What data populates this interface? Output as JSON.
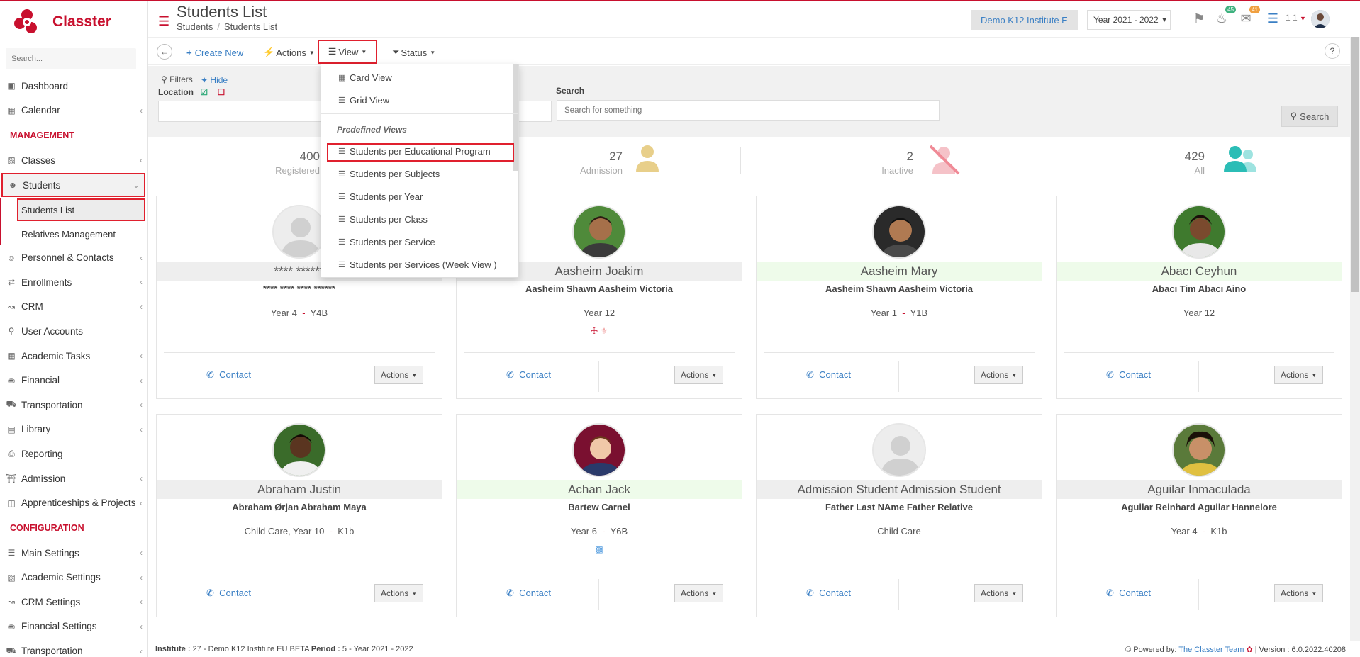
{
  "app": {
    "name": "Classter",
    "accent": "#c8102e",
    "link_color": "#3a7fc4"
  },
  "sidebar": {
    "search_placeholder": "Search...",
    "items": [
      {
        "label": "Dashboard",
        "icon": "laptop-icon"
      },
      {
        "label": "Calendar",
        "icon": "calendar-icon"
      }
    ],
    "management_header": "MANAGEMENT",
    "management": [
      {
        "label": "Classes",
        "icon": "classes-icon"
      },
      {
        "label": "Students",
        "icon": "students-icon"
      },
      {
        "label": "Students List"
      },
      {
        "label": "Relatives Management"
      },
      {
        "label": "Personnel & Contacts",
        "icon": "personnel-icon"
      },
      {
        "label": "Enrollments",
        "icon": "enrollments-icon"
      },
      {
        "label": "CRM",
        "icon": "crm-icon"
      },
      {
        "label": "User Accounts",
        "icon": "key-icon"
      },
      {
        "label": "Academic Tasks",
        "icon": "grid-icon"
      },
      {
        "label": "Financial",
        "icon": "coins-icon"
      },
      {
        "label": "Transportation",
        "icon": "bus-icon"
      },
      {
        "label": "Library",
        "icon": "library-icon"
      },
      {
        "label": "Reporting",
        "icon": "printer-icon"
      },
      {
        "label": "Admission",
        "icon": "bank-icon"
      },
      {
        "label": "Apprenticeships & Projects",
        "icon": "box-icon"
      }
    ],
    "configuration_header": "CONFIGURATION",
    "configuration": [
      {
        "label": "Main Settings",
        "icon": "sliders-icon"
      },
      {
        "label": "Academic Settings",
        "icon": "classes-icon"
      },
      {
        "label": "CRM Settings",
        "icon": "crm-icon"
      },
      {
        "label": "Financial Settings",
        "icon": "coins-icon"
      },
      {
        "label": "Transportation",
        "icon": "bus-icon"
      }
    ]
  },
  "header": {
    "title": "Students List",
    "breadcrumb": [
      "Students",
      "Students List"
    ],
    "institute": "Demo K12 Institute E",
    "year": "Year 2021 - 2022",
    "notif_count": "45",
    "mail_count": "41",
    "user_count": "1 1"
  },
  "toolbar": {
    "create": "Create New",
    "actions": "Actions",
    "view": "View",
    "status": "Status",
    "help": "?"
  },
  "filters": {
    "label": "Filters",
    "hide": "Hide",
    "location": "Location",
    "search_label": "Search",
    "search_placeholder": "Search for something",
    "search_button": "Search"
  },
  "view_menu": {
    "card_view": "Card View",
    "grid_view": "Grid View",
    "predefined_header": "Predefined Views",
    "predefined": [
      "Students per Educational Program",
      "Students per Subjects",
      "Students per Year",
      "Students per Class",
      "Students per Service",
      "Students per Services (Week View )"
    ]
  },
  "stats": [
    {
      "num": "400",
      "label": "Registered"
    },
    {
      "num": "27",
      "label": "Admission"
    },
    {
      "num": "2",
      "label": "Inactive"
    },
    {
      "num": "429",
      "label": "All"
    }
  ],
  "cards": [
    {
      "name": "**** ******",
      "parents": "**** **** **** ******",
      "year": "Year 4",
      "cls": "Y4B",
      "photo": "placeholder"
    },
    {
      "name": "Aasheim Joakim",
      "parents": "Aasheim Shawn Aasheim Victoria",
      "year": "Year 12",
      "cls": "",
      "photo": "boy1"
    },
    {
      "name": "Aasheim Mary",
      "parents": "Aasheim Shawn Aasheim Victoria",
      "year": "Year 1",
      "cls": "Y1B",
      "photo": "girl1"
    },
    {
      "name": "Abacı Ceyhun",
      "parents": "Abacı Tim Abacı Aino",
      "year": "Year 12",
      "cls": "",
      "photo": "boy2"
    },
    {
      "name": "Abraham Justin",
      "parents": "Abraham Ørjan Abraham Maya",
      "year": "Child Care, Year 10",
      "cls": "K1b",
      "photo": "boy3"
    },
    {
      "name": "Achan Jack",
      "parents": "Bartew Carnel",
      "year": "Year 6",
      "cls": "Y6B",
      "photo": "boy4"
    },
    {
      "name": "Admission Student Admission Student",
      "parents": "Father Last NAme Father Relative",
      "year": "Child Care",
      "cls": "",
      "photo": "placeholder"
    },
    {
      "name": "Aguilar Inmaculada",
      "parents": "Aguilar Reinhard Aguilar Hannelore",
      "year": "Year 4",
      "cls": "K1b",
      "photo": "girl2"
    }
  ],
  "card_labels": {
    "contact": "Contact",
    "actions": "Actions"
  },
  "footer": {
    "institute_label": "Institute :",
    "institute": "27 - Demo K12 Institute EU BETA",
    "period_label": "Period :",
    "period": "5 - Year 2021 - 2022",
    "powered": "Powered by:",
    "team": "The Classter Team",
    "version": "| Version : 6.0.2022.40208"
  }
}
